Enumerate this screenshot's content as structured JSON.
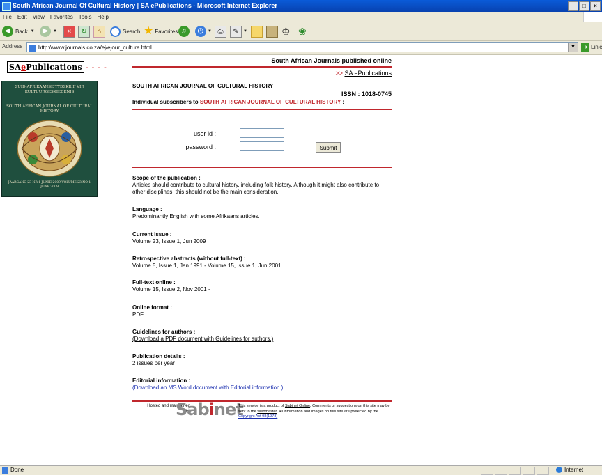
{
  "window": {
    "title": "South African Journal Of Cultural History | SA ePublications - Microsoft Internet Explorer",
    "controls": [
      "_",
      "□",
      "×"
    ]
  },
  "menu": [
    "File",
    "Edit",
    "View",
    "Favorites",
    "Tools",
    "Help"
  ],
  "toolbar": {
    "back": "Back",
    "search": "Search",
    "favorites": "Favorites"
  },
  "address": {
    "label": "Address",
    "url": "http://www.journals.co.za/ej/ejour_culture.html",
    "go": "Go",
    "links": "Links"
  },
  "status": {
    "text": "Done",
    "zone": "Internet"
  },
  "logo": {
    "part1": "SA",
    "part2": "e",
    "part3": "Publications",
    "dashes": "- - - -"
  },
  "cover": {
    "top_text": "SUID-AFRIKAANSE TYDSKRIF VIR KULTUURGESKIEDENIS",
    "sub_text": "SOUTH AFRICAN JOURNAL OF CULTURAL HISTORY",
    "bottom_text": "JAARGANG 23 NR 1 JUNIE 2009 VOLUME 23 NO 1 JUNE 2009"
  },
  "header": {
    "tag": "South African Journals published online",
    "arrows": ">> ",
    "sa_link": "SA ePublications",
    "journal_title": "SOUTH AFRICAN JOURNAL OF CULTURAL HISTORY",
    "issn": "ISSN : 1018-0745",
    "subscribers_prefix": "Individual subscribers to ",
    "subscribers_journal": "SOUTH AFRICAN JOURNAL OF CULTURAL HISTORY",
    "subscribers_suffix": " :"
  },
  "login": {
    "user_label": "user id :",
    "password_label": "password :",
    "user_value": "",
    "password_value": "",
    "submit": "Submit"
  },
  "sections": {
    "scope_head": "Scope of the publication :",
    "scope_text": "Articles should contribute to cultural history, including folk history. Although it might also contribute to other disciplines, this should not be the main consideration.",
    "language_head": "Language :",
    "language_text": "Predominantly English with some Afrikaans articles.",
    "current_head": "Current issue :",
    "current_text": "Volume 23, Issue 1, Jun 2009",
    "retro_head": "Retrospective abstracts (without full-text) :",
    "retro_text": "Volume 5, Issue 1, Jan 1991 - Volume 15, Issue 1, Jun 2001",
    "fulltext_head": "Full-text online :",
    "fulltext_text": "Volume 15, Issue 2, Nov 2001 -",
    "format_head": "Online format :",
    "format_text": "PDF",
    "guidelines_head": "Guidelines for authors :",
    "guidelines_link": "(Download a PDF document with Guidelines for authors.)",
    "pubdetails_head": "Publication details :",
    "pubdetails_text": "2 issues per year",
    "editorial_head": "Editorial information :",
    "editorial_link": "(Download an MS Word document with Editorial information.)"
  },
  "footer": {
    "hosted": "Hosted and maintained by:",
    "brand_a": "Sab",
    "brand_i": "i",
    "brand_b": "net",
    "service_1": "This service is a product of ",
    "service_link1": "Sabinet Online",
    "service_2": ". Comments or suggestions on this site may be sent to the ",
    "service_link2": "Webmaster",
    "service_3": ". All information and images on this site are protected by the ",
    "service_link3": "Copyright Act 98(1978)"
  }
}
